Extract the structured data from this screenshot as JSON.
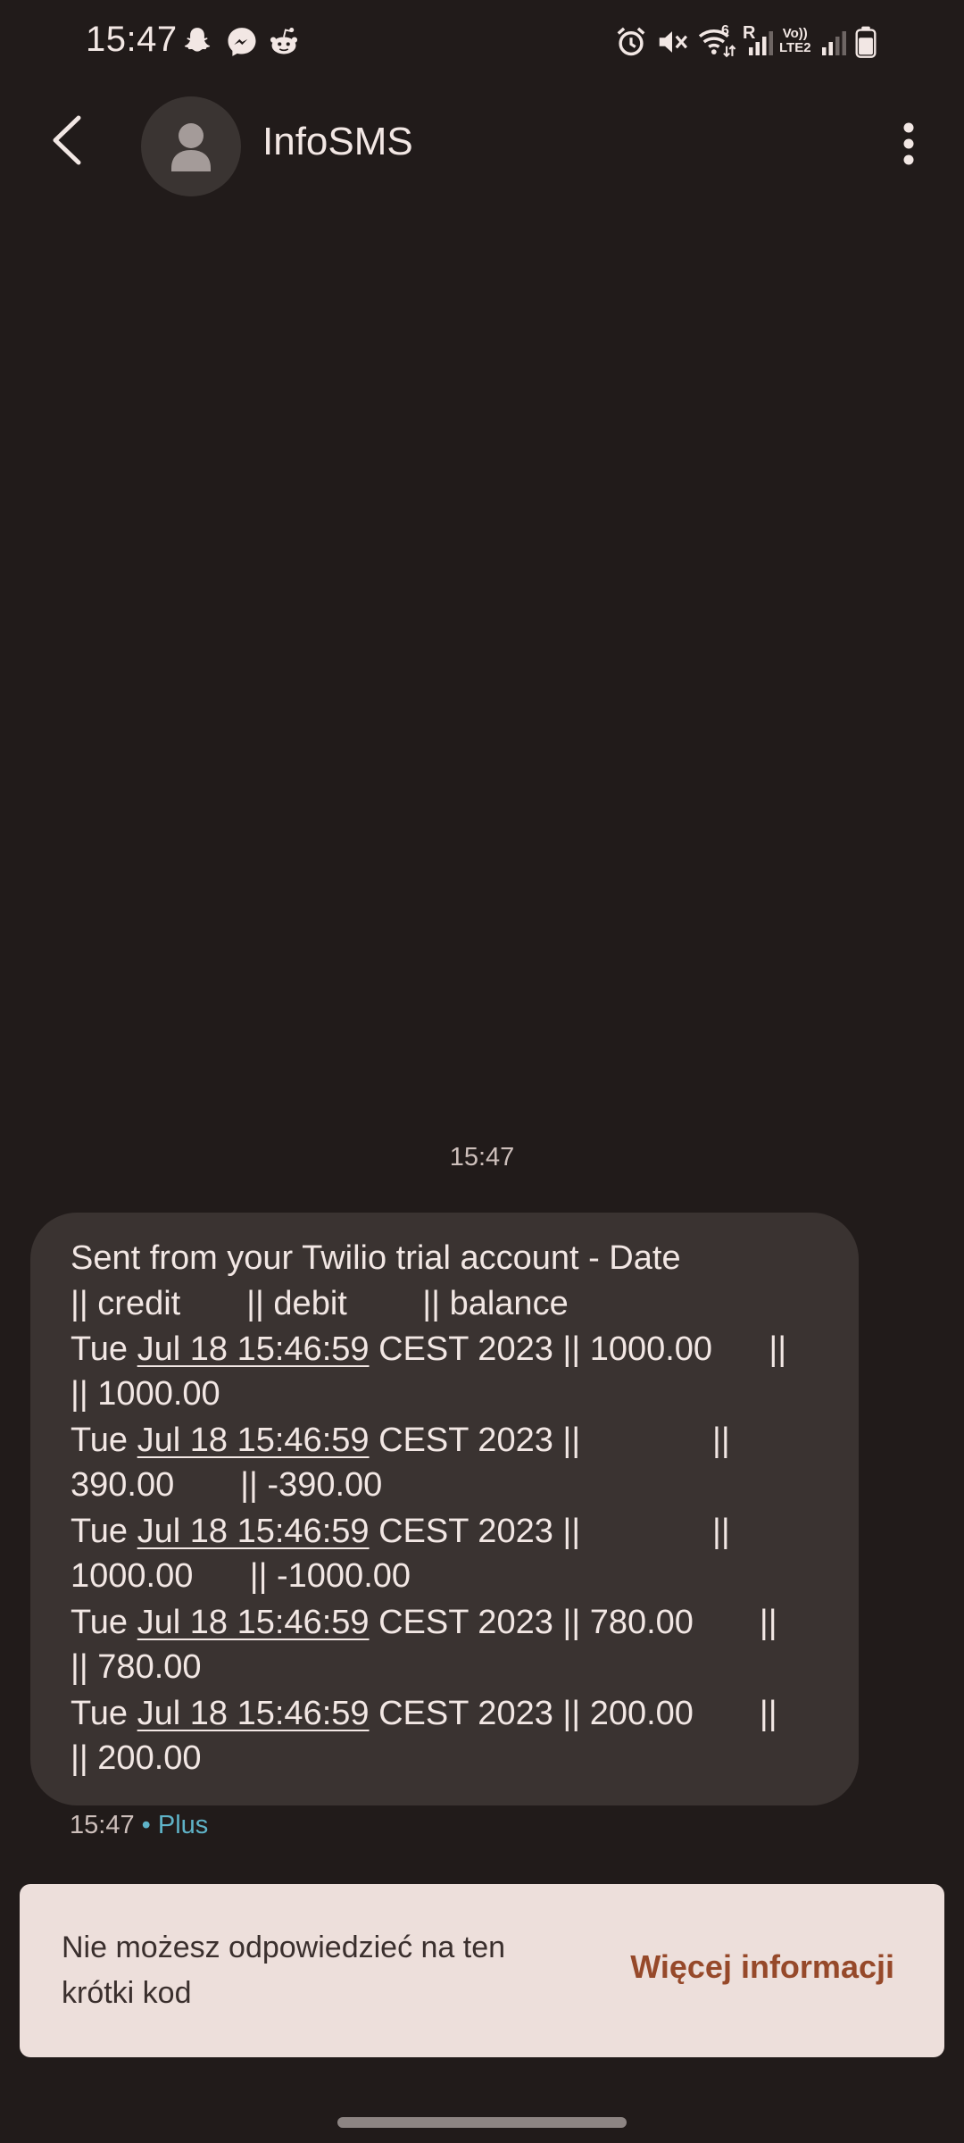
{
  "status_bar": {
    "time": "15:47",
    "left_icons": [
      "snapchat-icon",
      "messenger-icon",
      "reddit-icon"
    ],
    "right_icons": [
      "alarm-icon",
      "mute-icon",
      "wifi-icon",
      "signal-icon",
      "volte-icon",
      "signal-icon",
      "battery-icon"
    ],
    "wifi_label": "6",
    "roaming_label": "R",
    "volte_label_1": "Vo))",
    "volte_label_2": "LTE2"
  },
  "header": {
    "contact_name": "InfoSMS"
  },
  "conversation": {
    "time_divider": "15:47",
    "message": {
      "lines": [
        {
          "pre": "Sent from your Twilio trial account - Date",
          "link": "",
          "post": ""
        },
        {
          "pre": "|| credit       || debit        || balance",
          "link": "",
          "post": ""
        },
        {
          "pre": "Tue ",
          "link": "Jul 18 15:46:59",
          "post": " CEST 2023 || 1000.00      ||"
        },
        {
          "pre": "|| 1000.00",
          "link": "",
          "post": ""
        },
        {
          "pre": "Tue ",
          "link": "Jul 18 15:46:59",
          "post": " CEST 2023 ||              ||"
        },
        {
          "pre": "390.00       || -390.00",
          "link": "",
          "post": ""
        },
        {
          "pre": "Tue ",
          "link": "Jul 18 15:46:59",
          "post": " CEST 2023 ||              ||"
        },
        {
          "pre": "1000.00      || -1000.00",
          "link": "",
          "post": ""
        },
        {
          "pre": "Tue ",
          "link": "Jul 18 15:46:59",
          "post": " CEST 2023 || 780.00       ||"
        },
        {
          "pre": "|| 780.00",
          "link": "",
          "post": ""
        },
        {
          "pre": "Tue ",
          "link": "Jul 18 15:46:59",
          "post": " CEST 2023 || 200.00       ||"
        },
        {
          "pre": "|| 200.00",
          "link": "",
          "post": ""
        }
      ],
      "time": "15:47",
      "separator": "•",
      "plan": "Plus"
    }
  },
  "notice": {
    "text": "Nie możesz odpowiedzieć na ten krótki kod",
    "link": "Więcej informacji"
  },
  "colors": {
    "background": "#211b1a",
    "bubble": "#3a3331",
    "notice_background": "#eddfdb",
    "link_accent": "#96492a",
    "plan_accent": "#5fb3c8"
  }
}
